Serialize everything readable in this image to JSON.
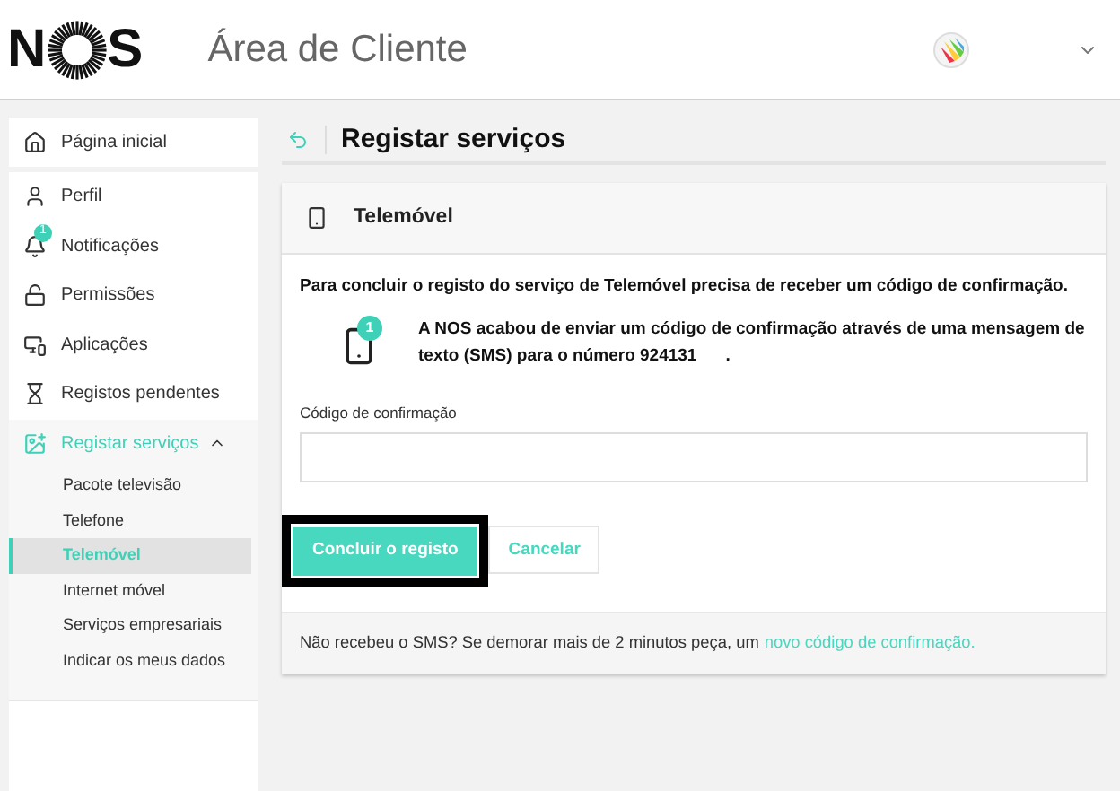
{
  "header": {
    "logo": {
      "left": "N",
      "right": "S"
    },
    "title": "Área de Cliente"
  },
  "sidebar": {
    "items": [
      {
        "label": "Página inicial",
        "selected": false
      },
      {
        "label": "Perfil",
        "selected": false
      },
      {
        "label": "Notificações",
        "selected": false,
        "badge": "1"
      },
      {
        "label": "Permissões",
        "selected": false
      },
      {
        "label": "Aplicações",
        "selected": false
      },
      {
        "label": "Registos pendentes",
        "selected": false
      },
      {
        "label": "Registar serviços",
        "selected": true,
        "expanded": true,
        "children": [
          {
            "label": "Pacote televisão",
            "selected": false
          },
          {
            "label": "Telefone",
            "selected": false
          },
          {
            "label": "Telemóvel",
            "selected": true
          },
          {
            "label": "Internet móvel",
            "selected": false
          },
          {
            "label": "Serviços empresariais",
            "selected": false
          },
          {
            "label": "Indicar os meus dados",
            "selected": false
          }
        ]
      }
    ]
  },
  "page": {
    "title": "Registar serviços"
  },
  "card": {
    "title": "Telemóvel",
    "intro": "Para concluir o registo do serviço de Telemóvel precisa de receber um código de confirmação.",
    "step_badge": "1",
    "message": "A NOS acabou de enviar um código de confirmação através de uma mensagem de texto (SMS) para o número 924131",
    "message_end": ".",
    "field": {
      "label": "Código de confirmação"
    },
    "buttons": [
      {
        "label": "Concluir o registo",
        "kind": "primary"
      },
      {
        "label": "Cancelar",
        "kind": "secondary"
      }
    ],
    "footer": {
      "text": "Não recebeu o SMS? Se demorar mais de 2 minutos peça, um",
      "link": "novo código de confirmação."
    }
  }
}
